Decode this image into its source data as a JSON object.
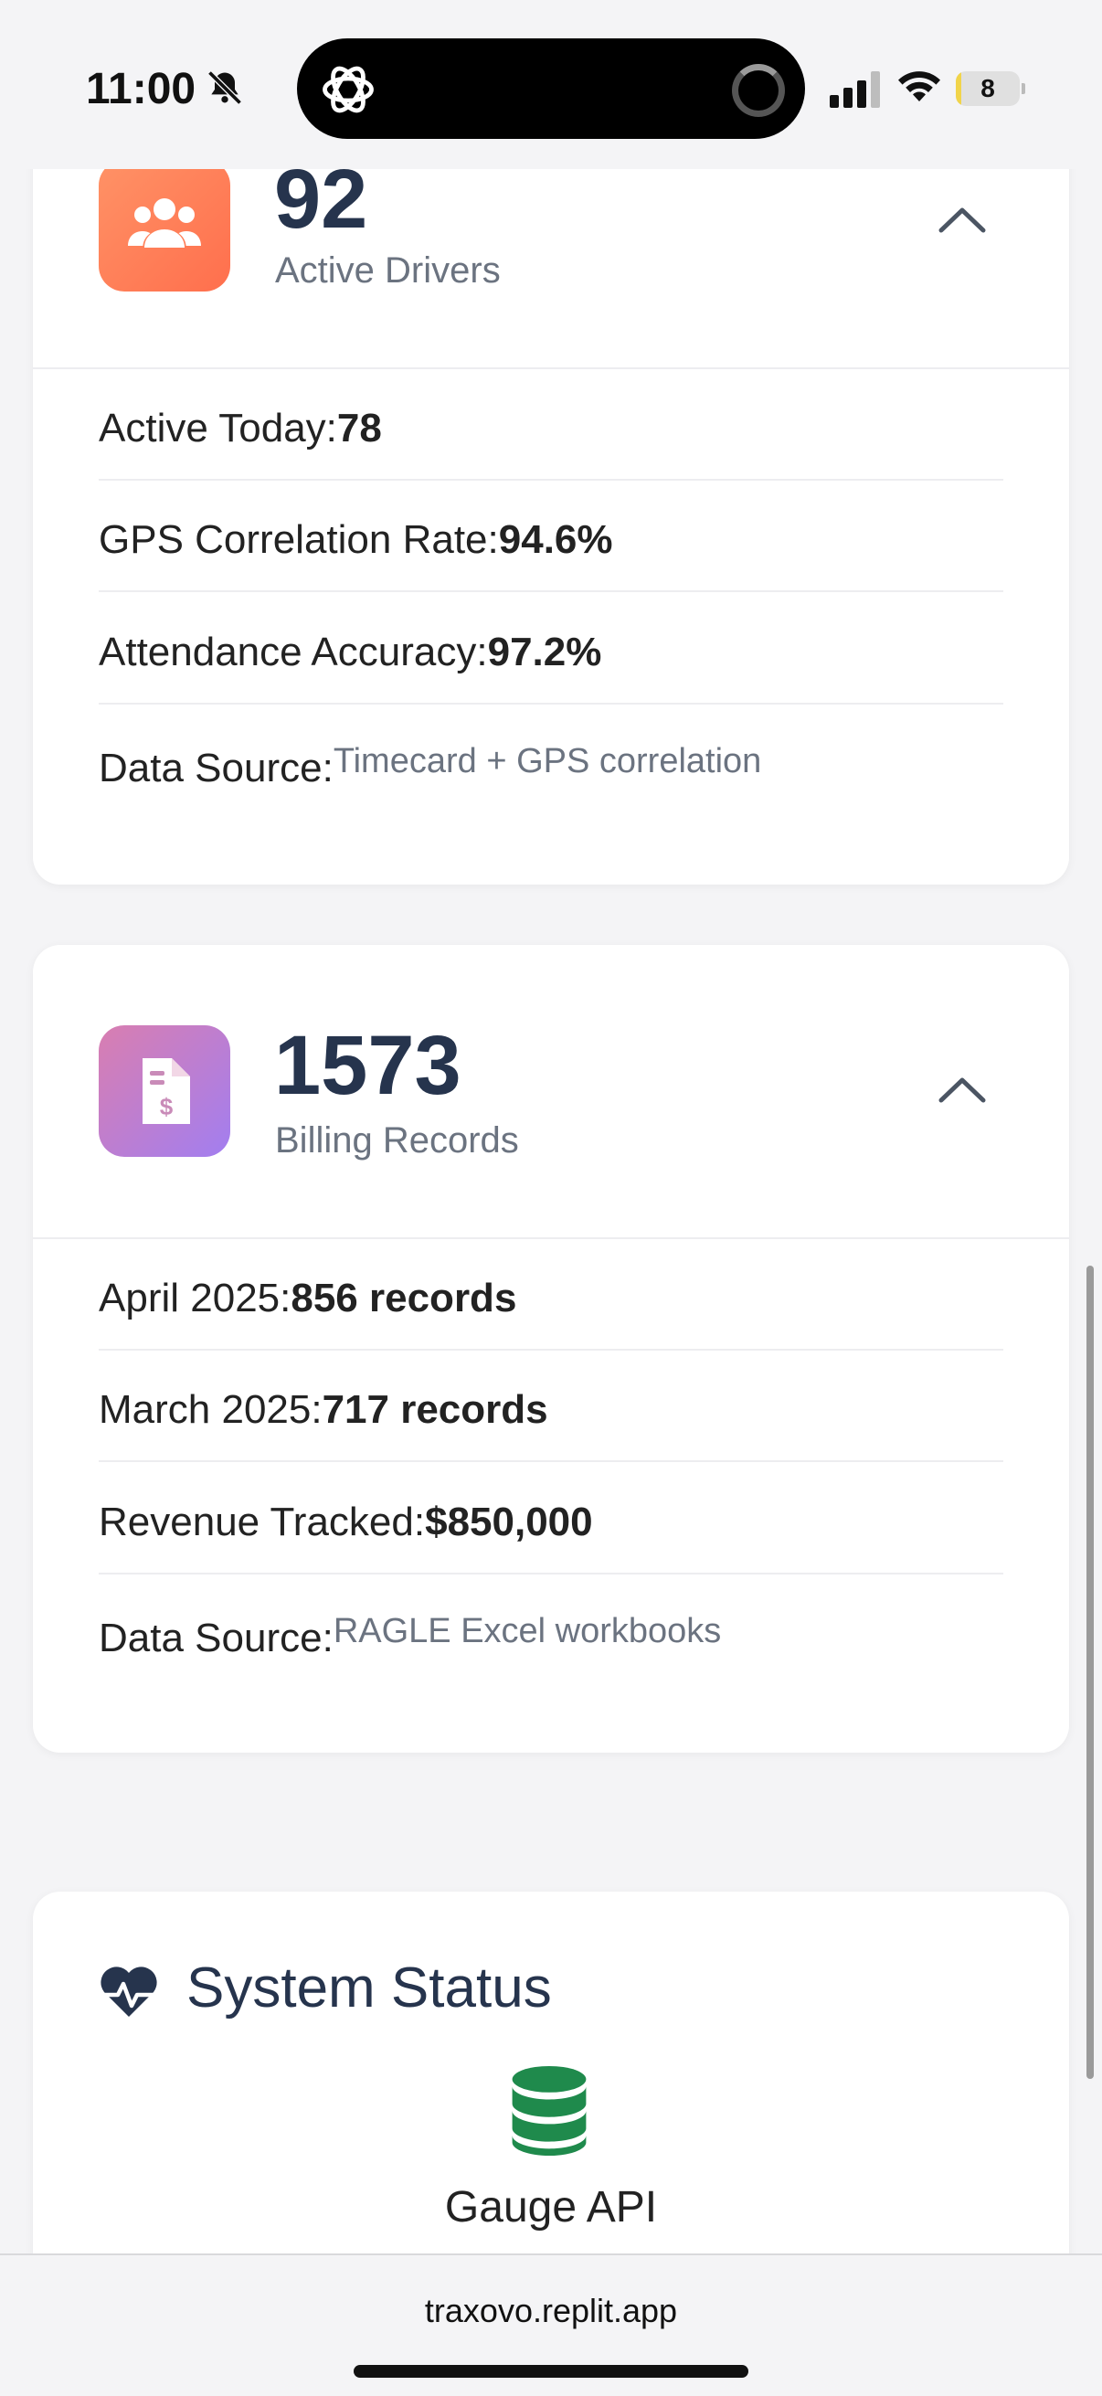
{
  "status_bar": {
    "time": "11:00",
    "battery_level": 8,
    "battery_text": "8"
  },
  "cards": [
    {
      "number": "92",
      "label": "Active Drivers",
      "icon": "users-icon",
      "rows": [
        {
          "label": "Active Today:",
          "value": "78"
        },
        {
          "label": "GPS Correlation Rate:",
          "value": "94.6%"
        },
        {
          "label": "Attendance Accuracy:",
          "value": "97.2%"
        },
        {
          "label": "Data Source:",
          "source": "Timecard + GPS correlation"
        }
      ]
    },
    {
      "number": "1573",
      "label": "Billing Records",
      "icon": "invoice-icon",
      "rows": [
        {
          "label": "April 2025:",
          "value": "856 records"
        },
        {
          "label": "March 2025:",
          "value": "717 records"
        },
        {
          "label": "Revenue Tracked:",
          "value": "$850,000"
        },
        {
          "label": "Data Source:",
          "source": "RAGLE Excel workbooks"
        }
      ]
    }
  ],
  "system_status": {
    "title": "System Status",
    "item_label": "Gauge API"
  },
  "browser": {
    "url": "traxovo.replit.app"
  },
  "colors": {
    "heading": "#26344d",
    "muted": "#6b7380",
    "db_green": "#1f8a4c",
    "tile_orange": "#ff7a55",
    "tile_purple": "#b67fd6"
  }
}
